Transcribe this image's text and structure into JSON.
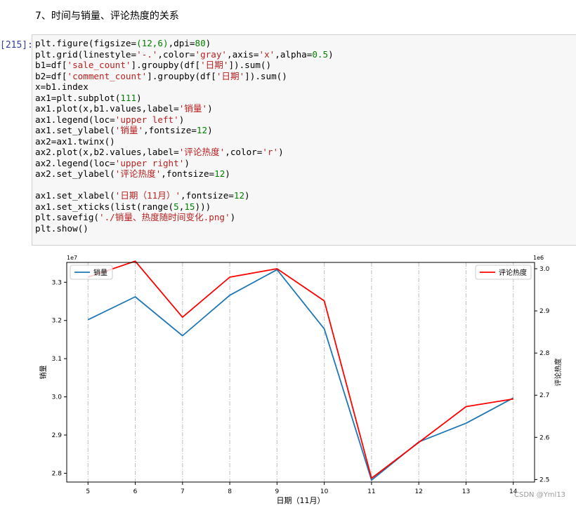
{
  "heading": "7、时间与销量、评论热度的关系",
  "cell": {
    "prompt": "[215]:",
    "lines": [
      [
        [
          "plt.figure(figsize=",
          ""
        ],
        [
          "(12,6)",
          "num"
        ],
        [
          ",dpi=",
          ""
        ],
        [
          "80",
          "num"
        ],
        [
          ")",
          ""
        ]
      ],
      [
        [
          "plt.grid(linestyle=",
          ""
        ],
        [
          "'-.'",
          "str"
        ],
        [
          ",color=",
          ""
        ],
        [
          "'gray'",
          "str"
        ],
        [
          ",axis=",
          ""
        ],
        [
          "'x'",
          "str"
        ],
        [
          ",alpha=",
          ""
        ],
        [
          "0.5",
          "num"
        ],
        [
          ")",
          ""
        ]
      ],
      [
        [
          "b1=df[",
          ""
        ],
        [
          "'sale_count'",
          "str"
        ],
        [
          "].groupby(df[",
          ""
        ],
        [
          "'日期'",
          "str"
        ],
        [
          "]).sum()",
          ""
        ]
      ],
      [
        [
          "b2=df[",
          ""
        ],
        [
          "'comment_count'",
          "str"
        ],
        [
          "].groupby(df[",
          ""
        ],
        [
          "'日期'",
          "str"
        ],
        [
          "]).sum()",
          ""
        ]
      ],
      [
        [
          "x=b1.index",
          ""
        ]
      ],
      [
        [
          "ax1=plt.subplot(",
          ""
        ],
        [
          "111",
          "num"
        ],
        [
          ")",
          ""
        ]
      ],
      [
        [
          "ax1.plot(x,b1.values,label=",
          ""
        ],
        [
          "'销量'",
          "str"
        ],
        [
          ")",
          ""
        ]
      ],
      [
        [
          "ax1.legend(loc=",
          ""
        ],
        [
          "'upper left'",
          "str"
        ],
        [
          ")",
          ""
        ]
      ],
      [
        [
          "ax1.set_ylabel(",
          ""
        ],
        [
          "'销量'",
          "str"
        ],
        [
          ",fontsize=",
          ""
        ],
        [
          "12",
          "num"
        ],
        [
          ")",
          ""
        ]
      ],
      [
        [
          "ax2=ax1.twinx()",
          ""
        ]
      ],
      [
        [
          "ax2.plot(x,b2.values,label=",
          ""
        ],
        [
          "'评论热度'",
          "str"
        ],
        [
          ",color=",
          ""
        ],
        [
          "'r'",
          "str"
        ],
        [
          ")",
          ""
        ]
      ],
      [
        [
          "ax2.legend(loc=",
          ""
        ],
        [
          "'upper right'",
          "str"
        ],
        [
          ")",
          ""
        ]
      ],
      [
        [
          "ax2.set_ylabel(",
          ""
        ],
        [
          "'评论热度'",
          "str"
        ],
        [
          ",fontsize=",
          ""
        ],
        [
          "12",
          "num"
        ],
        [
          ")",
          ""
        ]
      ],
      [
        [
          "",
          ""
        ]
      ],
      [
        [
          "ax1.set_xlabel(",
          ""
        ],
        [
          "'日期（11月）'",
          "str"
        ],
        [
          ",fontsize=",
          ""
        ],
        [
          "12",
          "num"
        ],
        [
          ")",
          ""
        ]
      ],
      [
        [
          "ax1.set_xticks(list(range(",
          ""
        ],
        [
          "5",
          "num"
        ],
        [
          ",",
          ""
        ],
        [
          "15",
          "num"
        ],
        [
          ")))",
          ""
        ]
      ],
      [
        [
          "plt.savefig(",
          ""
        ],
        [
          "'./销量、热度随时间变化.png'",
          "str"
        ],
        [
          ")",
          ""
        ]
      ],
      [
        [
          "plt.show()",
          ""
        ]
      ]
    ]
  },
  "chart_data": {
    "type": "line",
    "x": [
      5,
      6,
      7,
      8,
      9,
      10,
      11,
      12,
      13,
      14
    ],
    "xticks": [
      "5",
      "6",
      "7",
      "8",
      "9",
      "10",
      "11",
      "12",
      "13",
      "14"
    ],
    "xlim": [
      4.55,
      14.45
    ],
    "xlabel": "日期（11月）",
    "grid": "x, dash-dot, gray",
    "left_axis": {
      "ylabel": "销量",
      "offset_text": "1e7",
      "ylim": [
        2.777,
        3.352
      ],
      "ticks": [
        2.8,
        2.9,
        3.0,
        3.1,
        3.2,
        3.3
      ],
      "tick_labels": [
        "2.8",
        "2.9",
        "3.0",
        "3.1",
        "3.2",
        "3.3"
      ]
    },
    "right_axis": {
      "ylabel": "评论热度",
      "offset_text": "1e6",
      "ylim": [
        2.494,
        3.015
      ],
      "ticks": [
        2.5,
        2.6,
        2.7,
        2.8,
        2.9,
        3.0
      ],
      "tick_labels": [
        "2.5",
        "2.6",
        "2.7",
        "2.8",
        "2.9",
        "3.0"
      ]
    },
    "series": [
      {
        "name": "销量",
        "axis": "left",
        "color": "#1f77b4",
        "values": [
          3.202,
          3.262,
          3.16,
          3.266,
          3.333,
          3.178,
          2.782,
          2.882,
          2.931,
          2.997
        ]
      },
      {
        "name": "评论热度",
        "axis": "right",
        "color": "#ff0000",
        "values": [
          2.98,
          3.018,
          2.885,
          2.98,
          3.0,
          2.924,
          2.503,
          2.588,
          2.673,
          2.691
        ]
      }
    ],
    "legends": {
      "left": "upper left",
      "right": "upper right"
    }
  },
  "watermark": "CSDN @Yml13"
}
